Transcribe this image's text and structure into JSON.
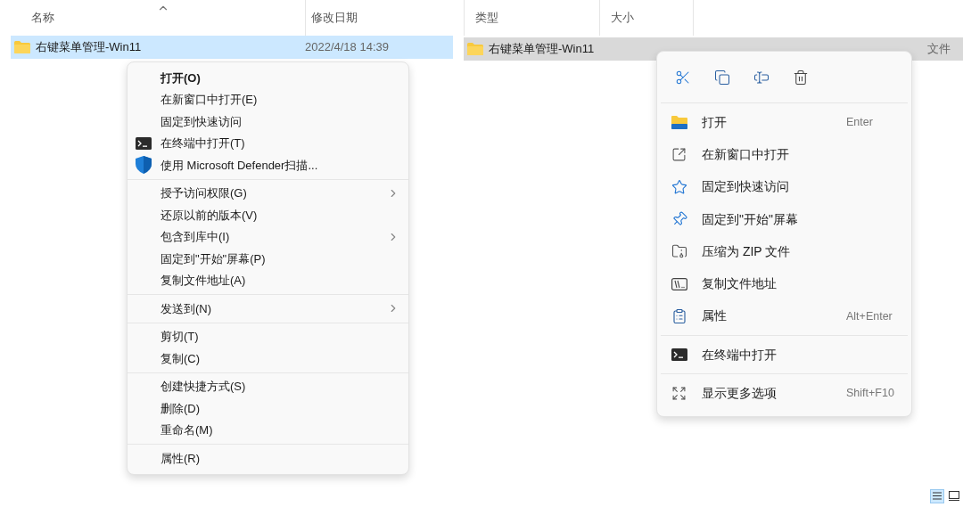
{
  "left_pane": {
    "columns": [
      {
        "label": "名称",
        "sorted": true
      },
      {
        "label": "修改日期",
        "sorted": false
      }
    ],
    "row": {
      "name": "右键菜单管理-Win11",
      "date": "2022/4/18 14:39",
      "selected": true
    },
    "context_menu": {
      "groups": [
        [
          {
            "label": "打开(O)",
            "default": true,
            "submenu": false
          },
          {
            "label": "在新窗口中打开(E)",
            "default": false,
            "submenu": false
          },
          {
            "label": "固定到快速访问",
            "default": false,
            "submenu": false
          },
          {
            "label": "在终端中打开(T)",
            "default": false,
            "submenu": false
          },
          {
            "label": "使用 Microsoft Defender扫描...",
            "default": false,
            "submenu": false
          }
        ],
        [
          {
            "label": "授予访问权限(G)",
            "default": false,
            "submenu": true
          },
          {
            "label": "还原以前的版本(V)",
            "default": false,
            "submenu": false
          },
          {
            "label": "包含到库中(I)",
            "default": false,
            "submenu": true
          },
          {
            "label": "固定到\"开始\"屏幕(P)",
            "default": false,
            "submenu": false
          },
          {
            "label": "复制文件地址(A)",
            "default": false,
            "submenu": false
          }
        ],
        [
          {
            "label": "发送到(N)",
            "default": false,
            "submenu": true
          }
        ],
        [
          {
            "label": "剪切(T)",
            "default": false,
            "submenu": false
          },
          {
            "label": "复制(C)",
            "default": false,
            "submenu": false
          }
        ],
        [
          {
            "label": "创建快捷方式(S)",
            "default": false,
            "submenu": false
          },
          {
            "label": "删除(D)",
            "default": false,
            "submenu": false
          },
          {
            "label": "重命名(M)",
            "default": false,
            "submenu": false
          }
        ],
        [
          {
            "label": "属性(R)",
            "default": false,
            "submenu": false
          }
        ]
      ]
    }
  },
  "right_pane": {
    "columns": [
      {
        "label": "类型"
      },
      {
        "label": "大小"
      }
    ],
    "row": {
      "name": "右键菜单管理-Win11",
      "type": "文件",
      "selected": true
    },
    "context_menu": {
      "groups": [
        [
          {
            "label": "打开",
            "shortcut": "Enter"
          },
          {
            "label": "在新窗口中打开"
          },
          {
            "label": "固定到快速访问"
          },
          {
            "label": "固定到\"开始\"屏幕"
          },
          {
            "label": "压缩为 ZIP 文件"
          },
          {
            "label": "复制文件地址"
          },
          {
            "label": "属性",
            "shortcut": "Alt+Enter"
          }
        ],
        [
          {
            "label": "在终端中打开"
          }
        ],
        [
          {
            "label": "显示更多选项",
            "shortcut": "Shift+F10"
          }
        ]
      ]
    }
  },
  "view_buttons": [
    {
      "selected": true
    },
    {
      "selected": false
    }
  ]
}
